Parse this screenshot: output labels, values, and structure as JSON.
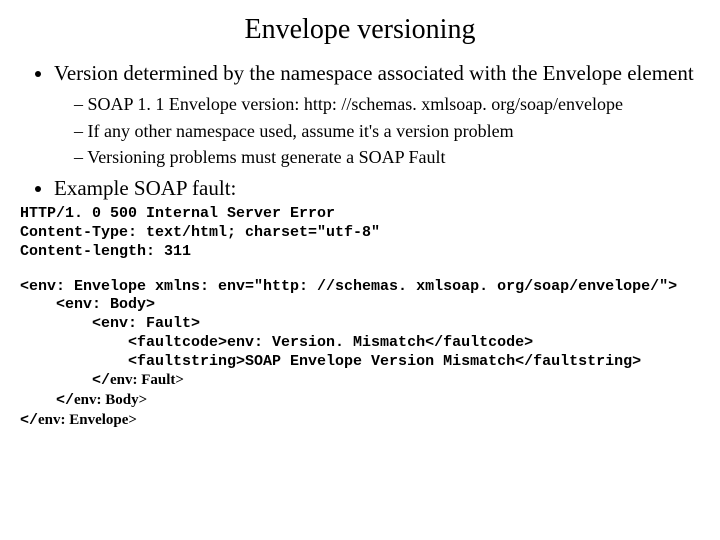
{
  "title": "Envelope versioning",
  "bullets": {
    "b1": "Version determined by the namespace associated with the Envelope element",
    "b1_sub": {
      "s1": "SOAP 1. 1 Envelope  version: http: //schemas. xmlsoap. org/soap/envelope",
      "s2": "If any other namespace used, assume it's a version problem",
      "s3": "Versioning problems must generate a SOAP Fault"
    },
    "b2": "Example SOAP fault:"
  },
  "http_headers": {
    "line1": "HTTP/1. 0 500 Internal Server Error",
    "line2": "Content-Type: text/html; charset=\"utf-8\"",
    "line3": "Content-length: 311"
  },
  "xml": {
    "l1": "<env: Envelope xmlns: env=\"http: //schemas. xmlsoap. org/soap/envelope/\">",
    "l2": "    <env: Body>",
    "l3": "        <env: Fault>",
    "l4": "            <faultcode>env: Version. Mismatch</faultcode>",
    "l5": "            <faultstring>SOAP Envelope Version Mismatch</faultstring>",
    "l6_a": "        </",
    "l6_b": "env: Fault>",
    "l7_a": "    </",
    "l7_b": "env: Body>",
    "l8_a": "</",
    "l8_b": "env: Envelope>"
  }
}
